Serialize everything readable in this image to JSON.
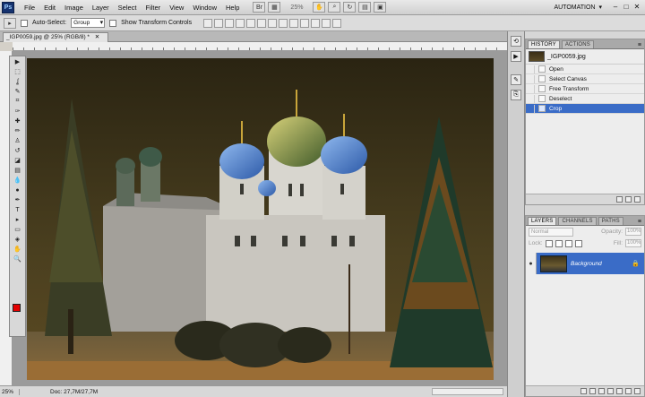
{
  "app": {
    "logo": "Ps",
    "menu": [
      "File",
      "Edit",
      "Image",
      "Layer",
      "Select",
      "Filter",
      "View",
      "Window",
      "Help"
    ],
    "zoom": "25%",
    "workspace": "AUTOMATION",
    "window_controls": [
      "–",
      "□",
      "✕"
    ]
  },
  "options_bar": {
    "auto_select_label": "Auto-Select:",
    "auto_select_value": "Group",
    "show_transform_label": "Show Transform Controls"
  },
  "document": {
    "tab_title": "_IGP0059.jpg @ 25% (RGB/8) *",
    "tab_close": "✕"
  },
  "status": {
    "zoom": "25%",
    "doc": "Doc: 27,7M/27,7M"
  },
  "toolbox": {
    "tools": [
      "move-tool",
      "marquee-tool",
      "lasso-tool",
      "quick-selection-tool",
      "crop-tool",
      "eyedropper-tool",
      "healing-tool",
      "brush-tool",
      "clone-stamp-tool",
      "history-brush-tool",
      "eraser-tool",
      "gradient-tool",
      "blur-tool",
      "dodge-tool",
      "pen-tool",
      "type-tool",
      "path-selection-tool",
      "shape-tool",
      "3d-tool",
      "hand-tool",
      "zoom-tool"
    ],
    "tool_glyphs": [
      "▶",
      "⬚",
      "ʆ",
      "✎",
      "⌗",
      "✑",
      "✚",
      "✏",
      "♙",
      "↺",
      "◪",
      "▤",
      "💧",
      "●",
      "✒",
      "T",
      "▸",
      "▭",
      "◈",
      "✋",
      "🔍"
    ],
    "foreground": "#e30000",
    "background": "#ffffff"
  },
  "history": {
    "tabs": [
      "HISTORY",
      "ACTIONS"
    ],
    "snapshot": "_IGP0059.jpg",
    "steps": [
      "Open",
      "Select Canvas",
      "Free Transform",
      "Deselect",
      "Crop"
    ],
    "active_step": "Crop",
    "menu_glyph": "≡"
  },
  "layers": {
    "tabs": [
      "LAYERS",
      "CHANNELS",
      "PATHS"
    ],
    "blend_mode": "Normal",
    "opacity_label": "Opacity:",
    "opacity_value": "100%",
    "lock_label": "Lock:",
    "fill_label": "Fill:",
    "fill_value": "100%",
    "layer_name": "Background",
    "eye": "●",
    "lock_glyph": "🔒"
  },
  "icon_strip": [
    "history-panel-icon",
    "actions-panel-icon",
    "brush-panel-icon",
    "clone-source-icon"
  ],
  "colors": {
    "selection_blue": "#3a6cc7",
    "panel_gray": "#d6d6d6"
  }
}
